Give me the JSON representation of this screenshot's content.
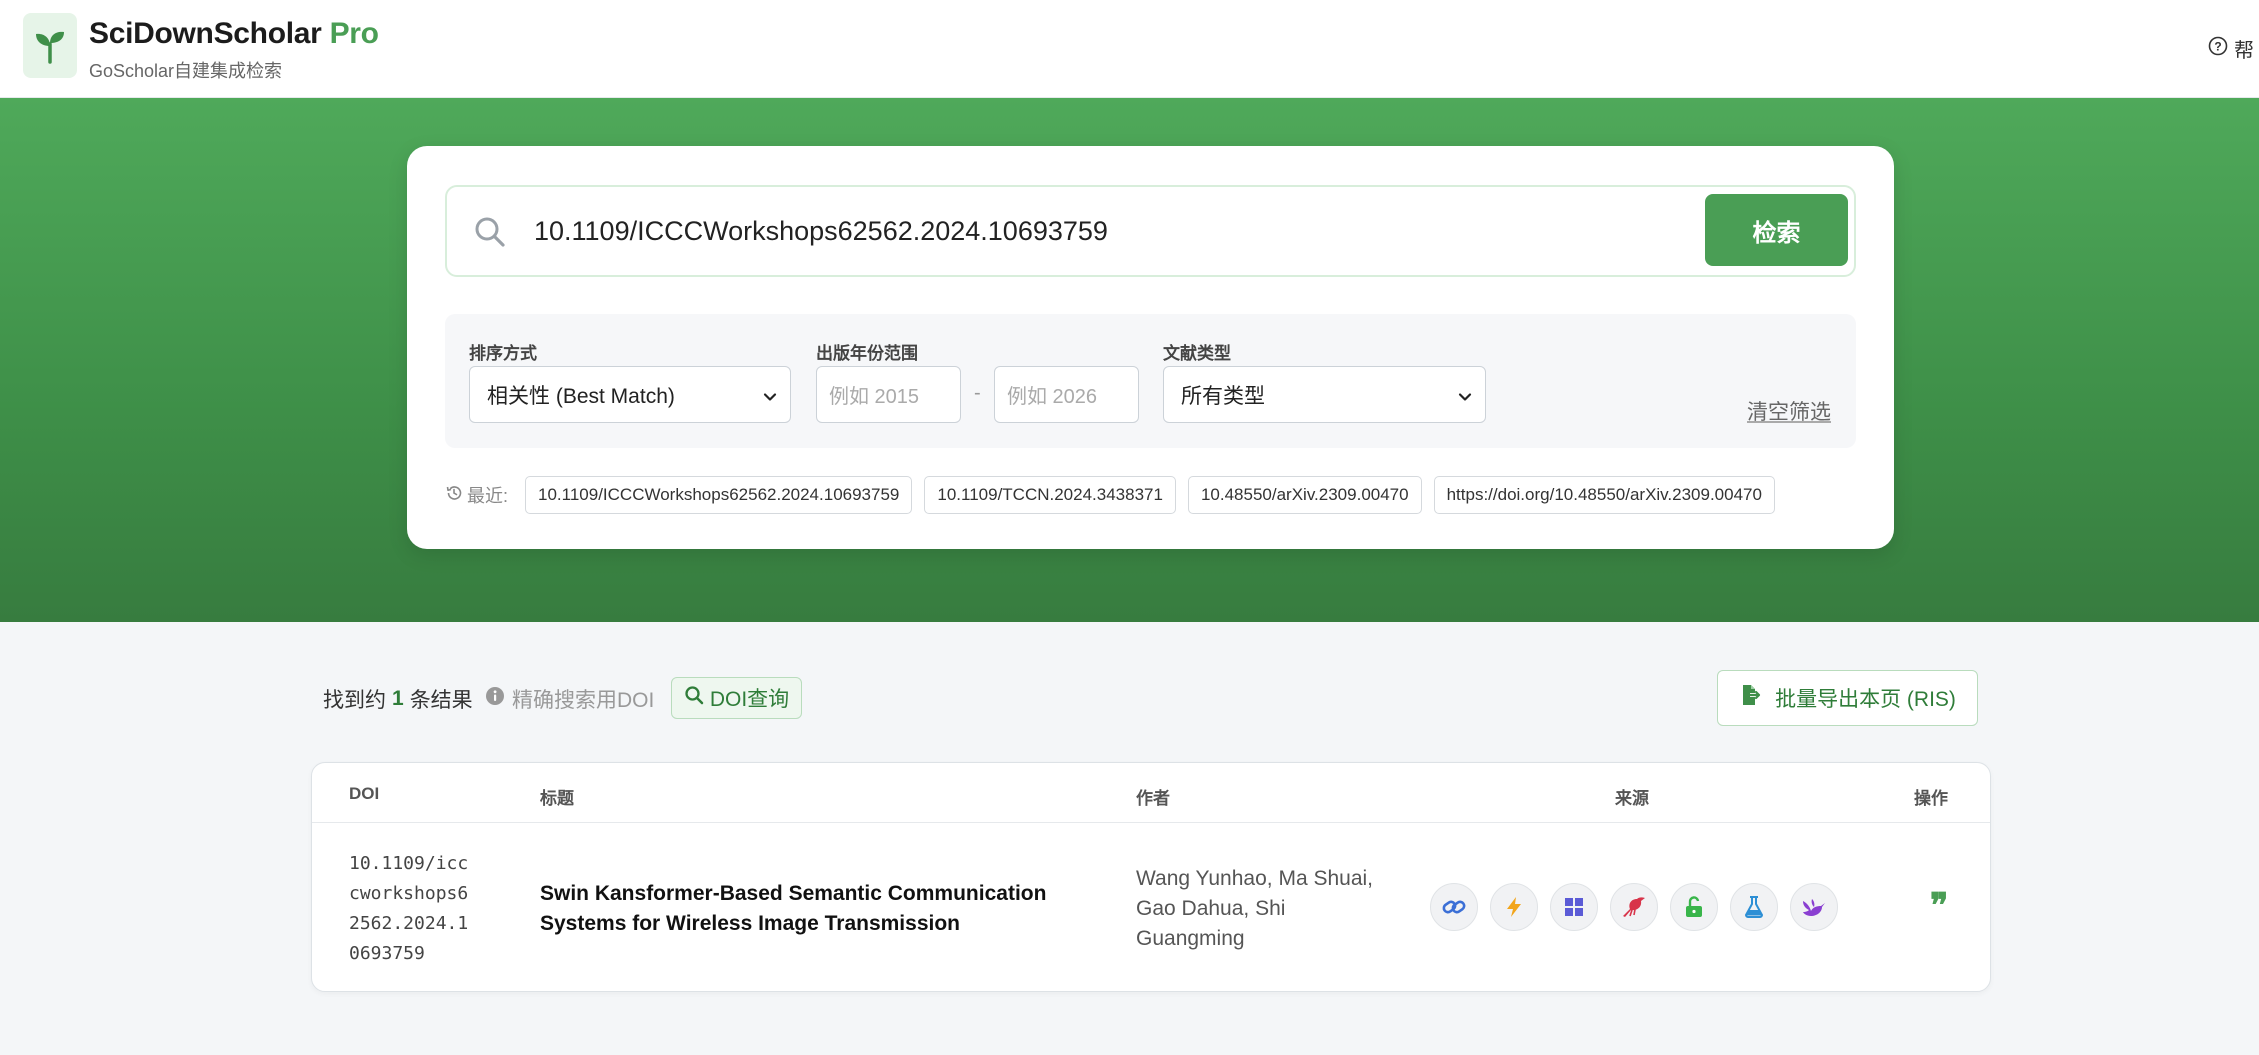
{
  "header": {
    "brand_main": "SciDownScholar",
    "brand_pro": "Pro",
    "subtitle": "GoScholar自建集成检索",
    "help_label": "帮"
  },
  "search": {
    "query": "10.1109/ICCCWorkshops62562.2024.10693759",
    "button_label": "检索"
  },
  "filters": {
    "sort_label": "排序方式",
    "sort_value": "相关性 (Best Match)",
    "year_label": "出版年份范围",
    "year_from_placeholder": "例如 2015",
    "year_sep": "-",
    "year_to_placeholder": "例如 2026",
    "type_label": "文献类型",
    "type_value": "所有类型",
    "clear_label": "清空筛选"
  },
  "recent": {
    "label": "最近:",
    "items": [
      "10.1109/ICCCWorkshops62562.2024.10693759",
      "10.1109/TCCN.2024.3438371",
      "10.48550/arXiv.2309.00470",
      "https://doi.org/10.48550/arXiv.2309.00470"
    ]
  },
  "results": {
    "count_prefix": "找到约",
    "count": "1",
    "count_suffix": "条结果",
    "hint": "精确搜索用DOI",
    "doi_query_label": "DOI查询",
    "export_label": "批量导出本页 (RIS)",
    "columns": [
      "DOI",
      "标题",
      "作者",
      "来源",
      "操作"
    ],
    "rows": [
      {
        "doi": "10.1109/icccworkshops62562.2024.10693759",
        "title": "Swin Kansformer-Based Semantic Communication Systems for Wireless Image Transmission",
        "authors": "Wang Yunhao, Ma Shuai, Gao Dahua, Shi Guangming",
        "cite_symbol": "❞"
      }
    ]
  },
  "source_icons": [
    "link-icon",
    "bolt-icon",
    "windows-grid-icon",
    "bird-icon",
    "unlock-icon",
    "flask-icon",
    "dove-icon"
  ],
  "colors": {
    "brand_green": "#4a9e55",
    "hero_green": "#4fa95a"
  }
}
